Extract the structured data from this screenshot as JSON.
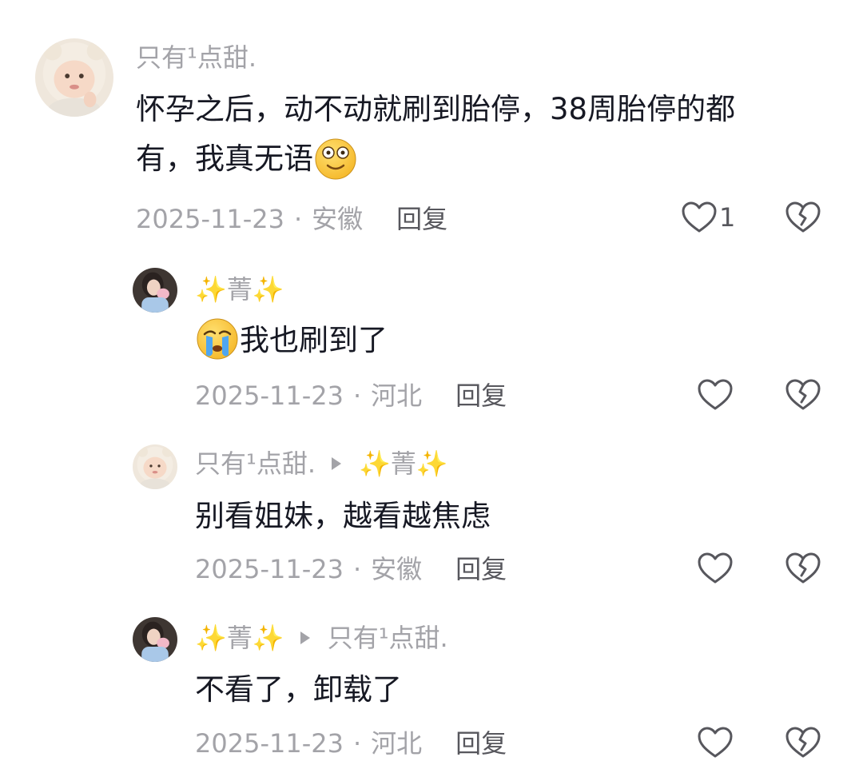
{
  "comments": [
    {
      "author": "只有¹点甜.",
      "text_line1": "怀孕之后，动不动就刷到胎停，38周胎停的都",
      "text_line2": "有，我真无语",
      "trailing_emoji": "flushed-face-emoji",
      "date": "2025-11-23",
      "separator": "·",
      "location": "安徽",
      "reply": "回复",
      "likes": "1"
    }
  ],
  "replies": [
    {
      "author": "✨菁✨",
      "leading_emoji": "crying-face-emoji",
      "text": "我也刷到了",
      "date": "2025-11-23",
      "separator": "·",
      "location": "河北",
      "reply": "回复"
    },
    {
      "author": "只有¹点甜.",
      "reply_to": "✨菁✨",
      "text": "别看姐妹，越看越焦虑",
      "date": "2025-11-23",
      "separator": "·",
      "location": "安徽",
      "reply": "回复"
    },
    {
      "author": "✨菁✨",
      "reply_to": "只有¹点甜.",
      "text": "不看了，卸载了",
      "date": "2025-11-23",
      "separator": "·",
      "location": "河北",
      "reply": "回复"
    }
  ],
  "icons": {
    "like": "heart-outline-icon",
    "dislike": "broken-heart-icon"
  },
  "colors": {
    "primary_text": "#161823",
    "secondary_text": "#a3a3a8",
    "reply_text": "#57575d",
    "icon": "#57575d"
  }
}
